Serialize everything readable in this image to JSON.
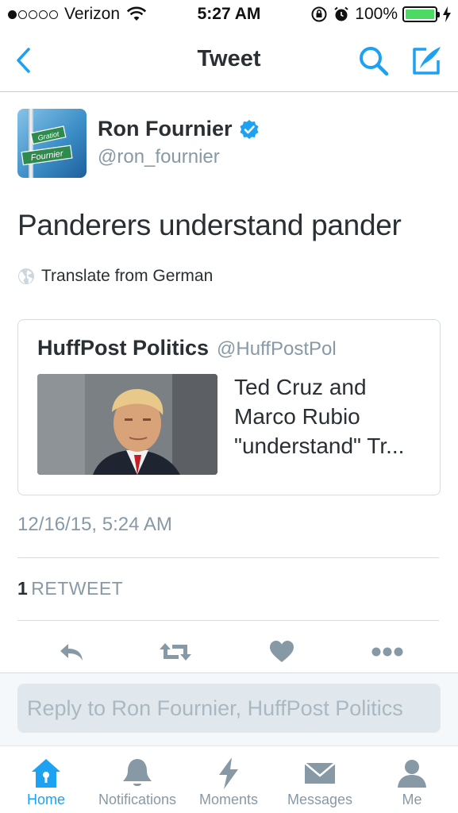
{
  "status_bar": {
    "carrier": "Verizon",
    "signal_dots_filled": 1,
    "signal_dots_total": 5,
    "time": "5:27 AM",
    "battery_percent": "100%"
  },
  "nav": {
    "title": "Tweet",
    "back_icon": "chevron-left-icon",
    "search_icon": "search-icon",
    "compose_icon": "compose-tweet-icon"
  },
  "author": {
    "name": "Ron Fournier",
    "handle": "@ron_fournier",
    "verified": true,
    "avatar_sign_texts": [
      "Gratiot",
      "Fournier"
    ]
  },
  "tweet": {
    "text": "Panderers understand pander",
    "translate_label": "Translate from German",
    "timestamp": "12/16/15, 5:24 AM"
  },
  "card": {
    "source_name": "HuffPost Politics",
    "source_handle": "@HuffPostPol",
    "headline": "Ted Cruz and Marco Rubio \"understand\" Tr..."
  },
  "stats": {
    "retweet_count": "1",
    "retweet_label": "RETWEET"
  },
  "actions": {
    "reply_icon": "reply-icon",
    "retweet_icon": "retweet-icon",
    "like_icon": "heart-icon",
    "more_icon": "more-icon"
  },
  "reply": {
    "placeholder": "Reply to Ron Fournier, HuffPost Politics"
  },
  "tabs": [
    {
      "label": "Home",
      "icon": "home-icon",
      "active": true
    },
    {
      "label": "Notifications",
      "icon": "bell-icon",
      "active": false
    },
    {
      "label": "Moments",
      "icon": "lightning-icon",
      "active": false
    },
    {
      "label": "Messages",
      "icon": "envelope-icon",
      "active": false
    },
    {
      "label": "Me",
      "icon": "person-icon",
      "active": false
    }
  ],
  "colors": {
    "accent": "#1da1f2",
    "text": "#292f33",
    "secondary": "#8899a6",
    "battery": "#4cd964"
  }
}
